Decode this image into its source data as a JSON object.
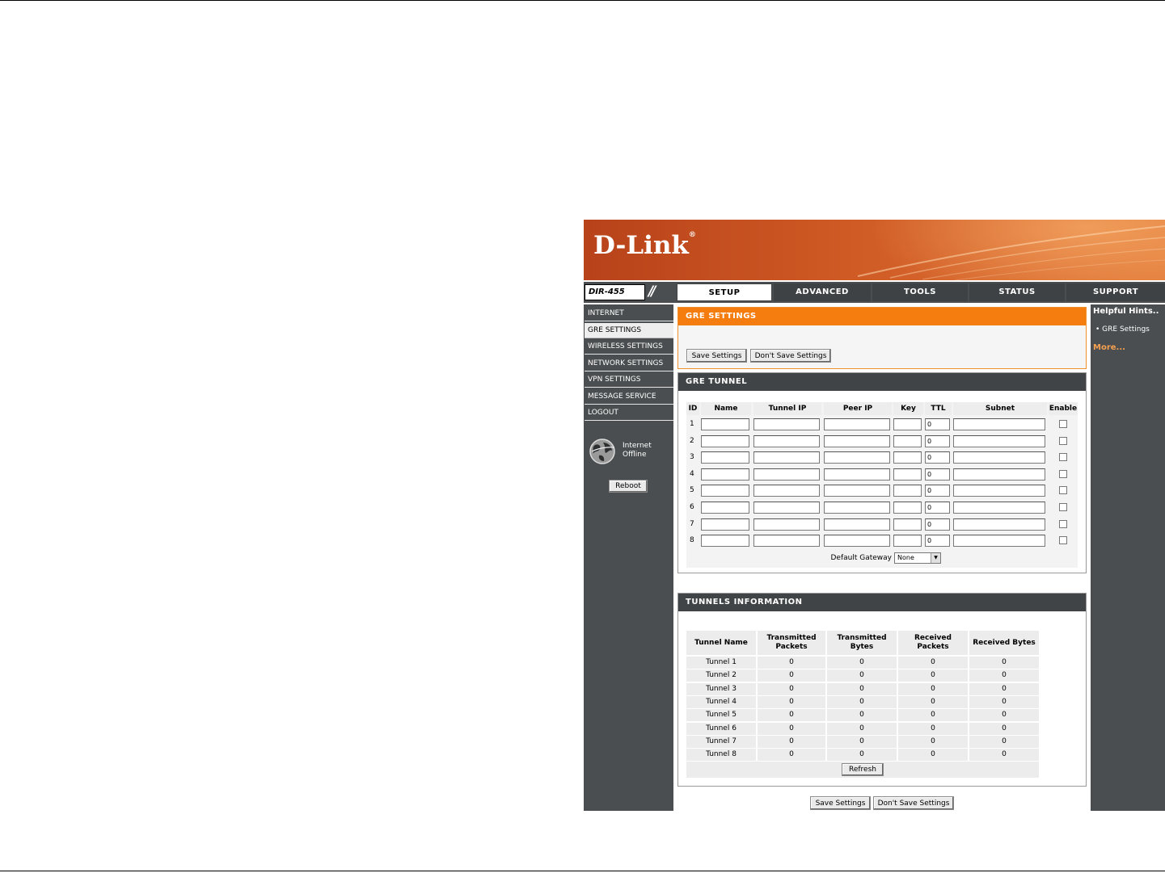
{
  "brand": {
    "logo": "D-Link",
    "model": "DIR-455"
  },
  "tabs": [
    "SETUP",
    "ADVANCED",
    "TOOLS",
    "STATUS",
    "SUPPORT"
  ],
  "sidebar": {
    "items": [
      "INTERNET",
      "GRE SETTINGS",
      "WIRELESS SETTINGS",
      "NETWORK SETTINGS",
      "VPN SETTINGS",
      "MESSAGE SERVICE",
      "LOGOUT"
    ],
    "status_line1": "Internet",
    "status_line2": "Offline",
    "reboot": "Reboot"
  },
  "hints": {
    "title": "Helpful Hints..",
    "item": "• GRE Settings",
    "more": "More..."
  },
  "gre_settings": {
    "title": "GRE SETTINGS",
    "save": "Save Settings",
    "dont_save": "Don't Save Settings"
  },
  "gre_tunnel": {
    "title": "GRE TUNNEL",
    "headers": [
      "ID",
      "Name",
      "Tunnel IP",
      "Peer IP",
      "Key",
      "TTL",
      "Subnet",
      "Enable"
    ],
    "ids": [
      "1",
      "2",
      "3",
      "4",
      "5",
      "6",
      "7",
      "8"
    ],
    "ttl_value": "0",
    "gateway_label": "Default Gateway",
    "gateway_value": "None"
  },
  "tunnels_info": {
    "title": "TUNNELS INFORMATION",
    "headers": [
      "Tunnel Name",
      "Transmitted Packets",
      "Transmitted Bytes",
      "Received Packets",
      "Received Bytes"
    ],
    "rows": [
      [
        "Tunnel 1",
        "0",
        "0",
        "0",
        "0"
      ],
      [
        "Tunnel 2",
        "0",
        "0",
        "0",
        "0"
      ],
      [
        "Tunnel 3",
        "0",
        "0",
        "0",
        "0"
      ],
      [
        "Tunnel 4",
        "0",
        "0",
        "0",
        "0"
      ],
      [
        "Tunnel 5",
        "0",
        "0",
        "0",
        "0"
      ],
      [
        "Tunnel 6",
        "0",
        "0",
        "0",
        "0"
      ],
      [
        "Tunnel 7",
        "0",
        "0",
        "0",
        "0"
      ],
      [
        "Tunnel 8",
        "0",
        "0",
        "0",
        "0"
      ]
    ],
    "refresh": "Refresh"
  },
  "footer": {
    "save": "Save Settings",
    "dont_save": "Don't Save Settings"
  }
}
